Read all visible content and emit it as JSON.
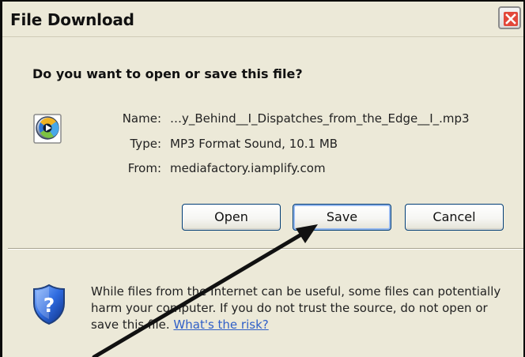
{
  "dialog": {
    "title": "File Download",
    "question": "Do you want to open or save this file?",
    "icon": "windows-media-player-file-icon",
    "close_icon": "close-icon"
  },
  "file": {
    "name_label": "Name:",
    "name_value": "…y_Behind__I_Dispatches_from_the_Edge__I_.mp3",
    "type_label": "Type:",
    "type_value": "MP3 Format Sound, 10.1 MB",
    "from_label": "From:",
    "from_value": "mediafactory.iamplify.com"
  },
  "buttons": {
    "open_label": "Open",
    "save_label": "Save",
    "cancel_label": "Cancel"
  },
  "security": {
    "icon": "shield-question-icon",
    "warning_text": "While files from the Internet can be useful, some files can potentially harm your computer. If you do not trust the source, do not open or save this file.",
    "risk_link": "What's the risk?"
  },
  "colors": {
    "window_background": "#ece9d8",
    "close_button_red": "#e2473a",
    "button_border": "#003c74",
    "link": "#2f5fc8",
    "arrow": "#111111"
  },
  "annotation": {
    "pointer": "arrow-pointing-to-save-button"
  }
}
